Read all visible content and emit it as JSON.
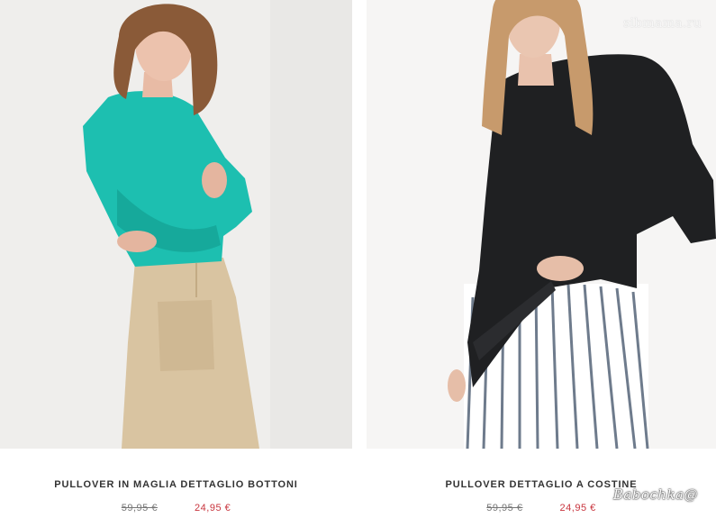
{
  "products": [
    {
      "name": "PULLOVER IN MAGLIA DETTAGLIO BOTTONI",
      "old_price": "59,95 €",
      "new_price": "24,95 €",
      "image": "woman-turquoise-sweater-beige-skirt"
    },
    {
      "name": "PULLOVER DETTAGLIO A COSTINE",
      "old_price": "59,95 €",
      "new_price": "24,95 €",
      "image": "woman-black-sweater-striped-trousers"
    }
  ],
  "watermark": "sibmama.ru",
  "signature": "Babochka@",
  "colors": {
    "sale_price": "#c8343d",
    "old_price": "#777777",
    "product_name": "#333333"
  }
}
